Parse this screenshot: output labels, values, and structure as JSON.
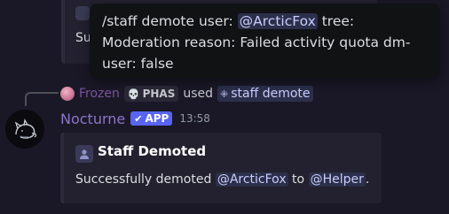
{
  "previous_embed": {
    "description_visible": "Suc"
  },
  "tooltip": {
    "line1_prefix": "/staff demote user: ",
    "line1_mention": "@ArcticFox",
    "line1_suffix": " tree:",
    "line2": "Moderation reason: Failed activity quota dm-",
    "line3": "user: false"
  },
  "reply": {
    "author": "Frozen",
    "tag": "PHAS",
    "used_text": "used",
    "command": "staff demote"
  },
  "message": {
    "author": "Nocturne",
    "badge": "APP",
    "timestamp": "13:58"
  },
  "embed": {
    "title": "Staff Demoted",
    "desc_prefix": "Successfully demoted ",
    "mention_user": "@ArcticFox",
    "desc_middle": " to ",
    "mention_role": "@Helper",
    "desc_suffix": "."
  },
  "colors": {
    "mention_bg": "#2b2f4a",
    "mention_fg": "#c9cdfb",
    "app_badge": "#5865f2",
    "author": "#8a76c9"
  }
}
